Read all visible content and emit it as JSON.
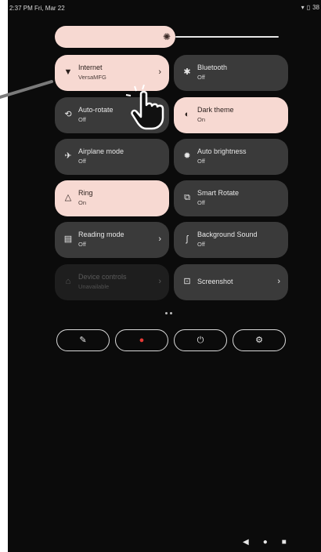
{
  "status": {
    "time_date": "2:37 PM Fri, Mar 22",
    "battery": "38"
  },
  "brightness": {
    "level": 0.54
  },
  "tiles": [
    {
      "label": "Internet",
      "sub": "VersaMFG",
      "on": true,
      "chevron": true,
      "icon": "wifi-icon"
    },
    {
      "label": "Bluetooth",
      "sub": "Off",
      "on": false,
      "chevron": false,
      "icon": "bluetooth-icon"
    },
    {
      "label": "Auto-rotate",
      "sub": "Off",
      "on": false,
      "chevron": false,
      "icon": "rotate-icon"
    },
    {
      "label": "Dark theme",
      "sub": "On",
      "on": true,
      "chevron": false,
      "icon": "contrast-icon"
    },
    {
      "label": "Airplane mode",
      "sub": "Off",
      "on": false,
      "chevron": false,
      "icon": "airplane-icon"
    },
    {
      "label": "Auto brightness",
      "sub": "Off",
      "on": false,
      "chevron": false,
      "icon": "brightness-icon"
    },
    {
      "label": "Ring",
      "sub": "On",
      "on": true,
      "chevron": false,
      "icon": "bell-icon"
    },
    {
      "label": "Smart Rotate",
      "sub": "Off",
      "on": false,
      "chevron": false,
      "icon": "smart-rotate-icon"
    },
    {
      "label": "Reading mode",
      "sub": "Off",
      "on": false,
      "chevron": true,
      "icon": "reading-mode-icon"
    },
    {
      "label": "Background Sound",
      "sub": "Off",
      "on": false,
      "chevron": false,
      "icon": "ear-icon"
    },
    {
      "label": "Device controls",
      "sub": "Unavailable",
      "on": false,
      "chevron": true,
      "disabled": true,
      "icon": "home-icon"
    },
    {
      "label": "Screenshot",
      "sub": "",
      "on": false,
      "chevron": true,
      "icon": "screenshot-icon"
    }
  ],
  "footer": {
    "icons": [
      "edit-icon",
      "user-icon",
      "power-icon",
      "settings-icon"
    ]
  },
  "colors": {
    "tile_on": "#f7d9d2",
    "tile_off": "#3a3a3a",
    "background": "#0b0b0b",
    "user_accent": "#e53935"
  }
}
